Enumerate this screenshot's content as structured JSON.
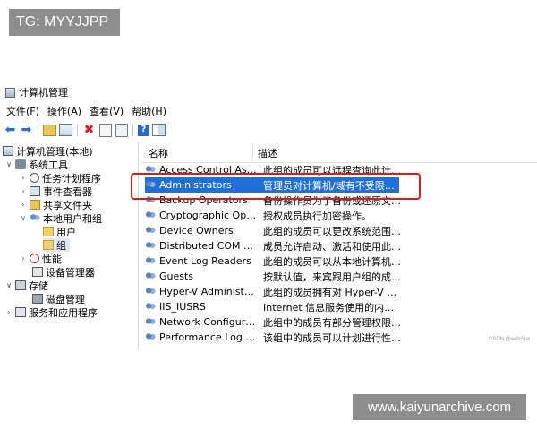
{
  "overlay": {
    "tg_badge": "TG: MYYJJPP",
    "site_badge": "www.kaiyunarchive.com",
    "watermark": "CSDN @webSue"
  },
  "window": {
    "title": "计算机管理"
  },
  "menu": [
    "文件(F)",
    "操作(A)",
    "查看(V)",
    "帮助(H)"
  ],
  "toolbar_icons": [
    "back-arrow-icon",
    "forward-arrow-icon",
    "up-folder-icon",
    "show-hide-tree-icon",
    "delete-icon",
    "properties-icon",
    "export-list-icon",
    "help-icon",
    "action-pane-icon"
  ],
  "tree": {
    "root": "计算机管理(本地)",
    "system_tools": "系统工具",
    "task_scheduler": "任务计划程序",
    "event_viewer": "事件查看器",
    "shared_folders": "共享文件夹",
    "local_users_groups": "本地用户和组",
    "users": "用户",
    "groups": "组",
    "performance": "性能",
    "device_manager": "设备管理器",
    "storage": "存储",
    "disk_management": "磁盘管理",
    "services_apps": "服务和应用程序"
  },
  "list": {
    "col_name": "名称",
    "col_desc": "描述",
    "rows": [
      {
        "name": "Access Control Assist...",
        "desc": "此组的成员可以远程查询此计算..."
      },
      {
        "name": "Administrators",
        "desc": "管理员对计算机/域有不受限制的..."
      },
      {
        "name": "Backup Operators",
        "desc": "备份操作员为了备份或还原文件..."
      },
      {
        "name": "Cryptographic Operat...",
        "desc": "授权成员执行加密操作。"
      },
      {
        "name": "Device Owners",
        "desc": "此组的成员可以更改系统范围内..."
      },
      {
        "name": "Distributed COM Users",
        "desc": "成员允许启动、激活和使用此计..."
      },
      {
        "name": "Event Log Readers",
        "desc": "此组的成员可以从本地计算机中..."
      },
      {
        "name": "Guests",
        "desc": "按默认值，来宾跟用户组的成员..."
      },
      {
        "name": "Hyper-V Administrat...",
        "desc": "此组的成员拥有对 Hyper-V 所有..."
      },
      {
        "name": "IIS_IUSRS",
        "desc": "Internet 信息服务使用的内置组。"
      },
      {
        "name": "Network Configuratio...",
        "desc": "此组中的成员有部分管理权限来..."
      },
      {
        "name": "Performance Log Users",
        "desc": "该组中的成员可以计划进行性能..."
      }
    ]
  }
}
